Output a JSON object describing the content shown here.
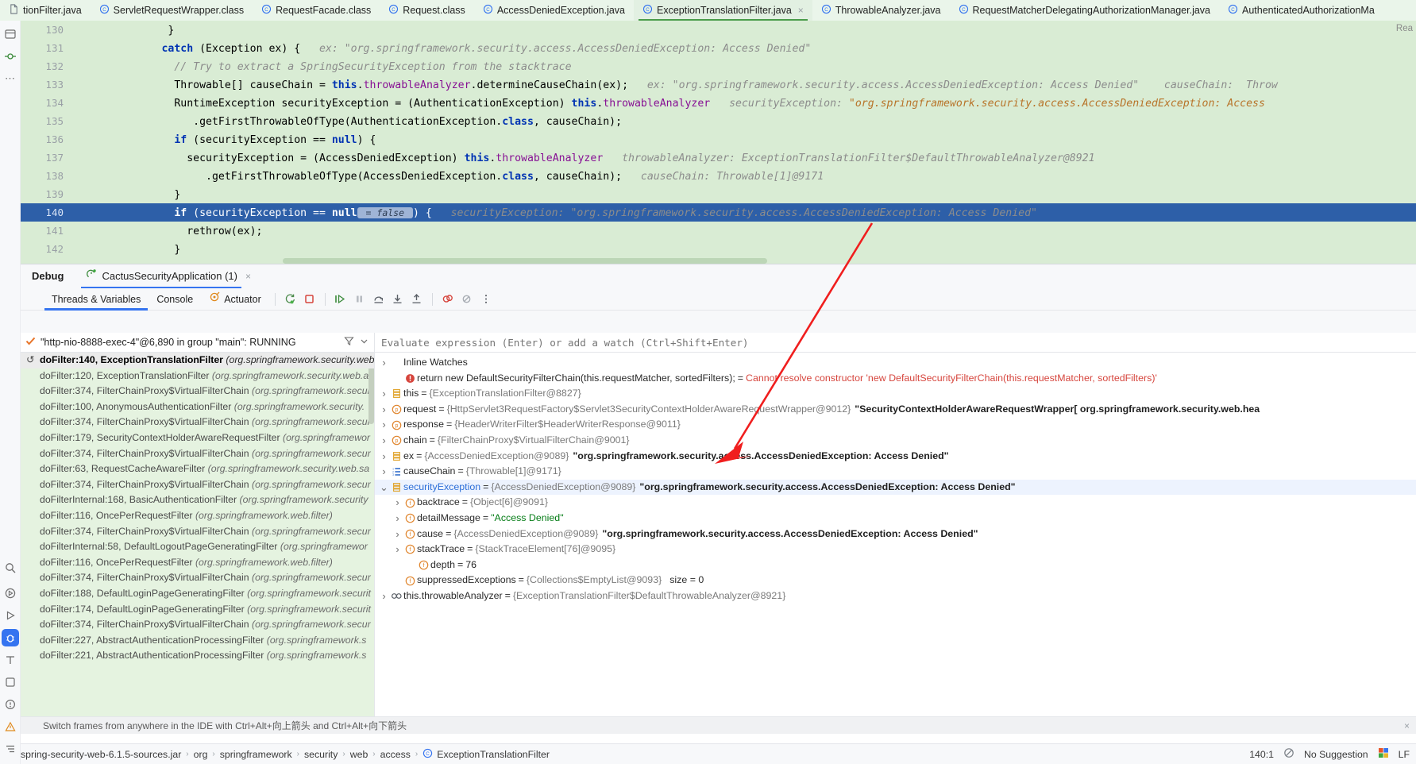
{
  "tabs": [
    {
      "label": "tionFilter.java",
      "icon": "file-icon",
      "active": false,
      "closable": false
    },
    {
      "label": "ServletRequestWrapper.class",
      "icon": "class-icon",
      "active": false,
      "closable": false
    },
    {
      "label": "RequestFacade.class",
      "icon": "class-icon",
      "active": false,
      "closable": false
    },
    {
      "label": "Request.class",
      "icon": "class-icon",
      "active": false,
      "closable": false
    },
    {
      "label": "AccessDeniedException.java",
      "icon": "class-icon",
      "active": false,
      "closable": false
    },
    {
      "label": "ExceptionTranslationFilter.java",
      "icon": "class-icon",
      "active": true,
      "closable": true
    },
    {
      "label": "ThrowableAnalyzer.java",
      "icon": "class-icon",
      "active": false,
      "closable": false
    },
    {
      "label": "RequestMatcherDelegatingAuthorizationManager.java",
      "icon": "class-icon",
      "active": false,
      "closable": false
    },
    {
      "label": "AuthenticatedAuthorizationMa",
      "icon": "class-icon",
      "active": false,
      "closable": false
    }
  ],
  "editor": {
    "read_only_label": "Rea",
    "lines": [
      {
        "num": "130",
        "indent": 10,
        "segments": [
          {
            "t": "}",
            "c": "cls"
          }
        ]
      },
      {
        "num": "131",
        "indent": 9,
        "segments": [
          {
            "t": "catch",
            "c": "kw"
          },
          {
            "t": " (Exception ex) {",
            "c": "cls"
          },
          {
            "t": "   ex: ",
            "c": "hint"
          },
          {
            "t": "\"org.springframework.security.access.AccessDeniedException: Access Denied\"",
            "c": "hint"
          }
        ]
      },
      {
        "num": "132",
        "indent": 11,
        "segments": [
          {
            "t": "// Try to extract a SpringSecurityException from the stacktrace",
            "c": "hint"
          }
        ]
      },
      {
        "num": "133",
        "indent": 11,
        "segments": [
          {
            "t": "Throwable[] causeChain = ",
            "c": "cls"
          },
          {
            "t": "this",
            "c": "kw"
          },
          {
            "t": ".",
            "c": "cls"
          },
          {
            "t": "throwableAnalyzer",
            "c": "fld"
          },
          {
            "t": ".determineCauseChain(ex);",
            "c": "cls"
          },
          {
            "t": "   ex: ",
            "c": "hint"
          },
          {
            "t": "\"org.springframework.security.access.AccessDeniedException: Access Denied\"",
            "c": "hint"
          },
          {
            "t": "    causeChain:  Throw",
            "c": "hint"
          }
        ]
      },
      {
        "num": "134",
        "indent": 11,
        "segments": [
          {
            "t": "RuntimeException securityException = (AuthenticationException) ",
            "c": "cls"
          },
          {
            "t": "this",
            "c": "kw"
          },
          {
            "t": ".",
            "c": "cls"
          },
          {
            "t": "throwableAnalyzer",
            "c": "fld"
          },
          {
            "t": "   securityException: ",
            "c": "hint"
          },
          {
            "t": "\"org.springframework.security.access.AccessDeniedException: Access",
            "c": "hint-val"
          }
        ]
      },
      {
        "num": "135",
        "indent": 14,
        "segments": [
          {
            "t": ".getFirstThrowableOfType(AuthenticationException.",
            "c": "cls"
          },
          {
            "t": "class",
            "c": "kw"
          },
          {
            "t": ", causeChain);",
            "c": "cls"
          }
        ]
      },
      {
        "num": "136",
        "indent": 11,
        "segments": [
          {
            "t": "if",
            "c": "kw"
          },
          {
            "t": " (securityException == ",
            "c": "cls"
          },
          {
            "t": "null",
            "c": "kw"
          },
          {
            "t": ") {",
            "c": "cls"
          }
        ]
      },
      {
        "num": "137",
        "indent": 13,
        "segments": [
          {
            "t": "securityException = (AccessDeniedException) ",
            "c": "cls"
          },
          {
            "t": "this",
            "c": "kw"
          },
          {
            "t": ".",
            "c": "cls"
          },
          {
            "t": "throwableAnalyzer",
            "c": "fld"
          },
          {
            "t": "   throwableAnalyzer: ExceptionTranslationFilter$DefaultThrowableAnalyzer@8921",
            "c": "hint"
          }
        ]
      },
      {
        "num": "138",
        "indent": 16,
        "segments": [
          {
            "t": ".getFirstThrowableOfType(AccessDeniedException.",
            "c": "cls"
          },
          {
            "t": "class",
            "c": "kw"
          },
          {
            "t": ", causeChain);",
            "c": "cls"
          },
          {
            "t": "   causeChain: Throwable[1]@9171",
            "c": "hint"
          }
        ]
      },
      {
        "num": "139",
        "indent": 11,
        "segments": [
          {
            "t": "}",
            "c": "cls"
          }
        ]
      },
      {
        "num": "140",
        "indent": 11,
        "current": true,
        "segments": [
          {
            "t": "if",
            "c": "kw"
          },
          {
            "t": " (securityException == ",
            "c": "cls"
          },
          {
            "t": "null",
            "c": "kw"
          },
          {
            "t": " = false ",
            "c": "chip"
          },
          {
            "t": ") {",
            "c": "cls"
          },
          {
            "t": "   securityException: ",
            "c": "hint"
          },
          {
            "t": "\"org.springframework.security.access.AccessDeniedException: Access Denied\"",
            "c": "hint"
          }
        ]
      },
      {
        "num": "141",
        "indent": 13,
        "segments": [
          {
            "t": "rethrow(ex);",
            "c": "cls"
          }
        ]
      },
      {
        "num": "142",
        "indent": 11,
        "segments": [
          {
            "t": "}",
            "c": "cls"
          }
        ]
      }
    ]
  },
  "debug": {
    "window_label": "Debug",
    "run_config": "CactusSecurityApplication (1)",
    "run_config_close": "×",
    "subtabs": [
      {
        "label": "Threads & Variables",
        "active": true
      },
      {
        "label": "Console",
        "active": false
      },
      {
        "label": "Actuator",
        "active": false,
        "icon": "actuator-icon"
      }
    ],
    "toolbar_buttons": [
      {
        "name": "rerun-debug-button",
        "glyph": "rerun"
      },
      {
        "name": "stop-button",
        "glyph": "stop"
      },
      {
        "name": "resume-program-button",
        "glyph": "resume"
      },
      {
        "name": "pause-program-button",
        "glyph": "pause"
      },
      {
        "name": "step-over-button",
        "glyph": "step-over"
      },
      {
        "name": "step-into-button",
        "glyph": "step-into"
      },
      {
        "name": "step-out-button",
        "glyph": "step-out"
      },
      {
        "name": "view-breakpoints-button",
        "glyph": "breakpoints"
      },
      {
        "name": "mute-breakpoints-button",
        "glyph": "mute-breakpoints"
      },
      {
        "name": "more-options-button",
        "glyph": "more"
      }
    ],
    "thread_selector": "\"http-nio-8888-exec-4\"@6,890 in group \"main\": RUNNING",
    "frames": [
      {
        "method": "doFilter:140, ExceptionTranslationFilter",
        "pkg": "(org.springframework.security.web.a",
        "selected": true
      },
      {
        "method": "doFilter:120, ExceptionTranslationFilter",
        "pkg": "(org.springframework.security.web.a",
        "selected": false
      },
      {
        "method": "doFilter:374, FilterChainProxy$VirtualFilterChain",
        "pkg": "(org.springframework.secur",
        "selected": false
      },
      {
        "method": "doFilter:100, AnonymousAuthenticationFilter",
        "pkg": "(org.springframework.security.",
        "selected": false
      },
      {
        "method": "doFilter:374, FilterChainProxy$VirtualFilterChain",
        "pkg": "(org.springframework.secur",
        "selected": false
      },
      {
        "method": "doFilter:179, SecurityContextHolderAwareRequestFilter",
        "pkg": "(org.springframewor",
        "selected": false
      },
      {
        "method": "doFilter:374, FilterChainProxy$VirtualFilterChain",
        "pkg": "(org.springframework.secur",
        "selected": false
      },
      {
        "method": "doFilter:63, RequestCacheAwareFilter",
        "pkg": "(org.springframework.security.web.sa",
        "selected": false
      },
      {
        "method": "doFilter:374, FilterChainProxy$VirtualFilterChain",
        "pkg": "(org.springframework.secur",
        "selected": false
      },
      {
        "method": "doFilterInternal:168, BasicAuthenticationFilter",
        "pkg": "(org.springframework.security",
        "selected": false
      },
      {
        "method": "doFilter:116, OncePerRequestFilter",
        "pkg": "(org.springframework.web.filter)",
        "selected": false
      },
      {
        "method": "doFilter:374, FilterChainProxy$VirtualFilterChain",
        "pkg": "(org.springframework.secur",
        "selected": false
      },
      {
        "method": "doFilterInternal:58, DefaultLogoutPageGeneratingFilter",
        "pkg": "(org.springframewor",
        "selected": false
      },
      {
        "method": "doFilter:116, OncePerRequestFilter",
        "pkg": "(org.springframework.web.filter)",
        "selected": false
      },
      {
        "method": "doFilter:374, FilterChainProxy$VirtualFilterChain",
        "pkg": "(org.springframework.secur",
        "selected": false
      },
      {
        "method": "doFilter:188, DefaultLoginPageGeneratingFilter",
        "pkg": "(org.springframework.securit",
        "selected": false
      },
      {
        "method": "doFilter:174, DefaultLoginPageGeneratingFilter",
        "pkg": "(org.springframework.securit",
        "selected": false
      },
      {
        "method": "doFilter:374, FilterChainProxy$VirtualFilterChain",
        "pkg": "(org.springframework.secur",
        "selected": false
      },
      {
        "method": "doFilter:227, AbstractAuthenticationProcessingFilter",
        "pkg": "(org.springframework.s",
        "selected": false
      },
      {
        "method": "doFilter:221, AbstractAuthenticationProcessingFilter",
        "pkg": "(org.springframework.s",
        "selected": false
      }
    ],
    "evaluate_placeholder": "Evaluate expression (Enter) or add a watch (Ctrl+Shift+Enter)",
    "variables": [
      {
        "arrow": "right",
        "indent": 0,
        "icon": "none",
        "name": "Inline Watches",
        "style": "plain"
      },
      {
        "arrow": "none",
        "indent": 1,
        "icon": "error-icon",
        "name": "return new DefaultSecurityFilterChain(this.requestMatcher, sortedFilters);",
        "eq": "=",
        "value": "Cannot resolve constructor 'new DefaultSecurityFilterChain(this.requestMatcher, sortedFilters)'",
        "style": "error"
      },
      {
        "arrow": "right",
        "indent": 0,
        "icon": "object-icon",
        "name": "this",
        "eq": "=",
        "value": "{ExceptionTranslationFilter@8827}",
        "style": "obj"
      },
      {
        "arrow": "right",
        "indent": 0,
        "icon": "param-icon",
        "name": "request",
        "eq": "=",
        "value": "{HttpServlet3RequestFactory$Servlet3SecurityContextHolderAwareRequestWrapper@9012}",
        "tail": "\"SecurityContextHolderAwareRequestWrapper[ org.springframework.security.web.hea",
        "style": "obj"
      },
      {
        "arrow": "right",
        "indent": 0,
        "icon": "param-icon",
        "name": "response",
        "eq": "=",
        "value": "{HeaderWriterFilter$HeaderWriterResponse@9011}",
        "style": "obj"
      },
      {
        "arrow": "right",
        "indent": 0,
        "icon": "param-icon",
        "name": "chain",
        "eq": "=",
        "value": "{FilterChainProxy$VirtualFilterChain@9001}",
        "style": "obj"
      },
      {
        "arrow": "right",
        "indent": 0,
        "icon": "object-icon",
        "name": "ex",
        "eq": "=",
        "value": "{AccessDeniedException@9089}",
        "tail": "\"org.springframework.security.access.AccessDeniedException: Access Denied\"",
        "style": "obj"
      },
      {
        "arrow": "right",
        "indent": 0,
        "icon": "array-icon",
        "name": "causeChain",
        "eq": "=",
        "value": "{Throwable[1]@9171}",
        "style": "obj"
      },
      {
        "arrow": "down",
        "indent": 0,
        "icon": "object-icon",
        "name": "securityException",
        "eq": "=",
        "value": "{AccessDeniedException@9089}",
        "tail": "\"org.springframework.security.access.AccessDeniedException: Access Denied\"",
        "style": "obj",
        "selected": true,
        "name_style": "blue"
      },
      {
        "arrow": "right",
        "indent": 1,
        "icon": "field-icon",
        "name": "backtrace",
        "eq": "=",
        "value": "{Object[6]@9091}",
        "style": "obj"
      },
      {
        "arrow": "right",
        "indent": 1,
        "icon": "field-icon",
        "name": "detailMessage",
        "eq": "=",
        "value": "\"Access Denied\"",
        "style": "string"
      },
      {
        "arrow": "right",
        "indent": 1,
        "icon": "field-icon",
        "name": "cause",
        "eq": "=",
        "value": "{AccessDeniedException@9089}",
        "tail": "\"org.springframework.security.access.AccessDeniedException: Access Denied\"",
        "style": "obj"
      },
      {
        "arrow": "right",
        "indent": 1,
        "icon": "field-icon",
        "name": "stackTrace",
        "eq": "=",
        "value": "{StackTraceElement[76]@9095}",
        "style": "obj"
      },
      {
        "arrow": "none",
        "indent": 2,
        "icon": "field-icon",
        "name": "depth",
        "eq": "=",
        "value": "76",
        "style": "num"
      },
      {
        "arrow": "none",
        "indent": 1,
        "icon": "field-icon",
        "name": "suppressedExceptions",
        "eq": "=",
        "value": "{Collections$EmptyList@9093}",
        "tail2": "size = 0",
        "style": "obj"
      },
      {
        "arrow": "right",
        "indent": 0,
        "icon": "static-icon",
        "name": "this.throwableAnalyzer",
        "eq": "=",
        "value": "{ExceptionTranslationFilter$DefaultThrowableAnalyzer@8921}",
        "style": "obj"
      }
    ],
    "hint_text": "Switch frames from anywhere in the IDE with Ctrl+Alt+向上箭头 and Ctrl+Alt+向下箭头",
    "hint_close": "×"
  },
  "statusbar": {
    "breadcrumbs": [
      {
        "label": "spring-security-web-6.1.5-sources.jar",
        "icon": "jar-icon"
      },
      {
        "label": "org",
        "icon": "none"
      },
      {
        "label": "springframework",
        "icon": "none"
      },
      {
        "label": "security",
        "icon": "none"
      },
      {
        "label": "web",
        "icon": "none"
      },
      {
        "label": "access",
        "icon": "none"
      },
      {
        "label": "ExceptionTranslationFilter",
        "icon": "class-icon"
      }
    ],
    "caret_position": "140:1",
    "no_suggestion": "No Suggestion",
    "line_separator": "LF"
  },
  "left_rail": {
    "items": [
      {
        "name": "project-icon",
        "glyph": "▤"
      },
      {
        "name": "commit-icon",
        "glyph": "⎇"
      },
      {
        "name": "more-tool-windows-icon",
        "glyph": "⋯"
      },
      {
        "name": "search-everywhere-icon",
        "glyph": "⌕"
      },
      {
        "name": "run-icon",
        "glyph": "▷"
      },
      {
        "name": "services-icon",
        "glyph": "▷"
      },
      {
        "name": "debug-icon",
        "glyph": "☸",
        "selected": true
      },
      {
        "name": "terminal-icon",
        "glyph": "⊤"
      },
      {
        "name": "todo-icon",
        "glyph": "☑"
      },
      {
        "name": "problems-icon",
        "glyph": "ⓘ"
      },
      {
        "name": "warnings-icon",
        "glyph": "⚠"
      },
      {
        "name": "structure-icon",
        "glyph": "☰"
      }
    ]
  },
  "colors": {
    "editor_bg": "#d9ecd4",
    "current_line": "#2d5fa8",
    "accent_blue": "#3574f0",
    "tab_bg": "#eaf5ea",
    "frames_bg": "#e5f3e0",
    "error_red": "#d6453d",
    "annotation_red": "#f01e1e"
  }
}
